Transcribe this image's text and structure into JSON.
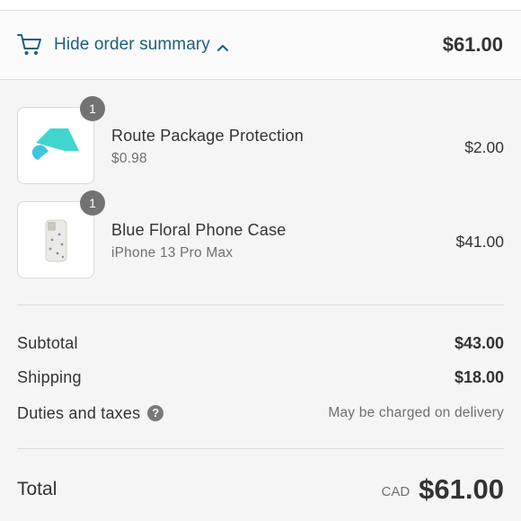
{
  "header": {
    "toggle_label": "Hide order summary",
    "total": "$61.00",
    "icons": [
      "cart-icon",
      "chevron-up-icon"
    ]
  },
  "items": [
    {
      "quantity": "1",
      "name": "Route Package Protection",
      "subtitle": "$0.98",
      "price": "$2.00",
      "thumbnail": "route-logo"
    },
    {
      "quantity": "1",
      "name": "Blue Floral Phone Case",
      "subtitle": "iPhone 13 Pro Max",
      "price": "$41.00",
      "thumbnail": "phone-case-image"
    }
  ],
  "costs": {
    "subtotal_label": "Subtotal",
    "subtotal_value": "$43.00",
    "shipping_label": "Shipping",
    "shipping_value": "$18.00",
    "duties_label": "Duties and taxes",
    "duties_help_icon": "?",
    "duties_note": "May be charged on delivery"
  },
  "total": {
    "label": "Total",
    "currency": "CAD",
    "value": "$61.00"
  },
  "colors": {
    "link": "#1d5e7c",
    "route_teal": "#40d6cf",
    "badge": "#737373"
  }
}
